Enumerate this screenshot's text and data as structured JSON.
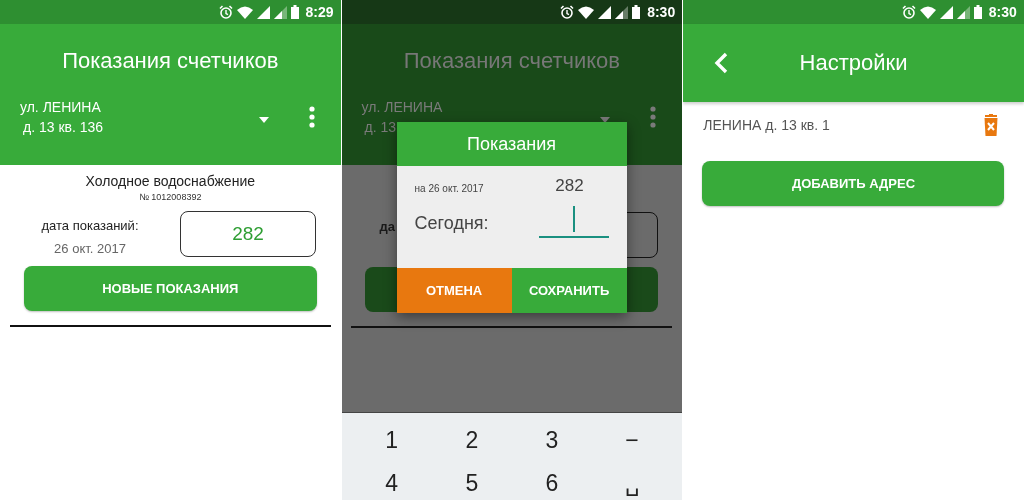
{
  "screens": [
    {
      "kind": "meters",
      "status_time": "8:29",
      "title": "Показания счетчиков",
      "address_line1": "ул. ЛЕНИНА",
      "address_line2": "д. 13 кв. 136",
      "meter": {
        "name": "Холодное водоснабжение",
        "number": "№ 1012008392",
        "date_label": "дата показаний:",
        "date": "26 окт. 2017",
        "reading": "282"
      },
      "button": "НОВЫЕ ПОКАЗАНИЯ"
    },
    {
      "kind": "dialog",
      "status_time": "8:30",
      "background": {
        "title": "Показания счетчиков",
        "address_line1": "ул. ЛЕНИНА",
        "address_fragment": "д. 13",
        "date_label_fragment": "да"
      },
      "dialog": {
        "title": "Показания",
        "previous_label": "на 26 окт. 2017",
        "previous_value": "282",
        "today_label": "Сегодня:",
        "cancel": "ОТМЕНА",
        "save": "СОХРАНИТЬ"
      },
      "keyboard": {
        "rows": [
          [
            "1",
            "2",
            "3",
            "−"
          ],
          [
            "4",
            "5",
            "6",
            "␣"
          ]
        ]
      }
    },
    {
      "kind": "settings",
      "status_time": "8:30",
      "title": "Настройки",
      "addresses": [
        "ЛЕНИНА д. 13 кв. 1"
      ],
      "button": "ДОБАВИТЬ АДРЕС"
    }
  ]
}
